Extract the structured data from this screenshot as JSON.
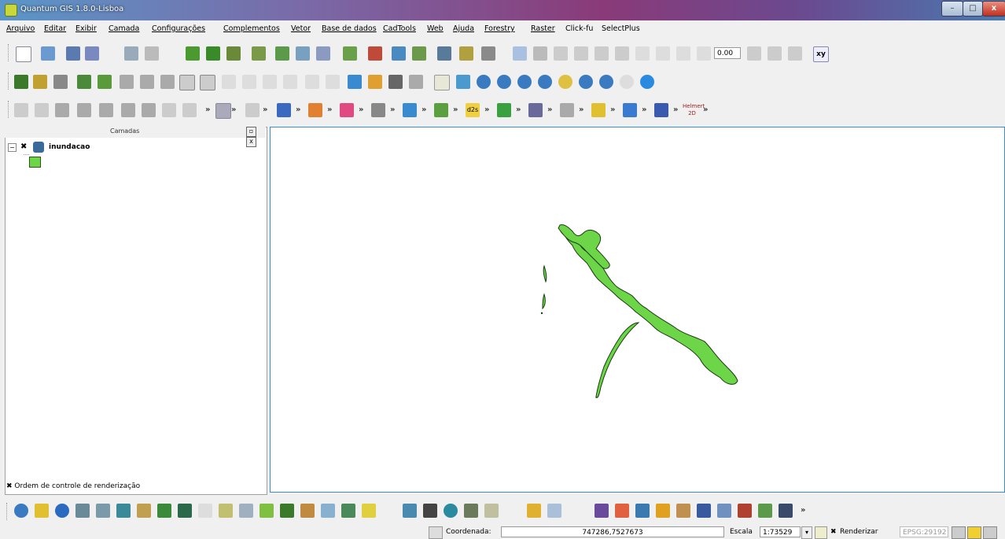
{
  "window": {
    "title": "Quantum GIS 1.8.0-Lisboa",
    "minimize": "–",
    "maximize": "□",
    "close": "x"
  },
  "menu": [
    "Arquivo",
    "Editar",
    "Exibir",
    "Camada",
    "Configurações",
    "Complementos",
    "Vetor",
    "Base de dados",
    "CadTools",
    "Web",
    "Ajuda",
    "Forestry",
    "Raster",
    "Click-fu",
    "SelectPlus"
  ],
  "toolbar1": {
    "scale_box": "0.00",
    "xy_label": "xy"
  },
  "toolbar3": {
    "chevron": "»",
    "d2s_label": "d2s",
    "helmert_label": "Helmert 2D"
  },
  "layers_panel": {
    "title": "Camadas",
    "float_btn": "▫",
    "close_btn": "x",
    "layers": [
      {
        "name": "inundacao",
        "checked": true,
        "fill_color": "#6cd648"
      }
    ]
  },
  "render_order": {
    "label": "Ordem de controle de renderização",
    "checked": true
  },
  "statusbar": {
    "coord_label": "Coordenada:",
    "coord_value": "747286,7527673",
    "scale_label": "Escala",
    "scale_value": "1:73529",
    "render_label": "Renderizar",
    "crs": "EPSG:29192"
  },
  "map": {
    "feature_fill": "#6cd648",
    "feature_stroke": "#1a3a10"
  }
}
